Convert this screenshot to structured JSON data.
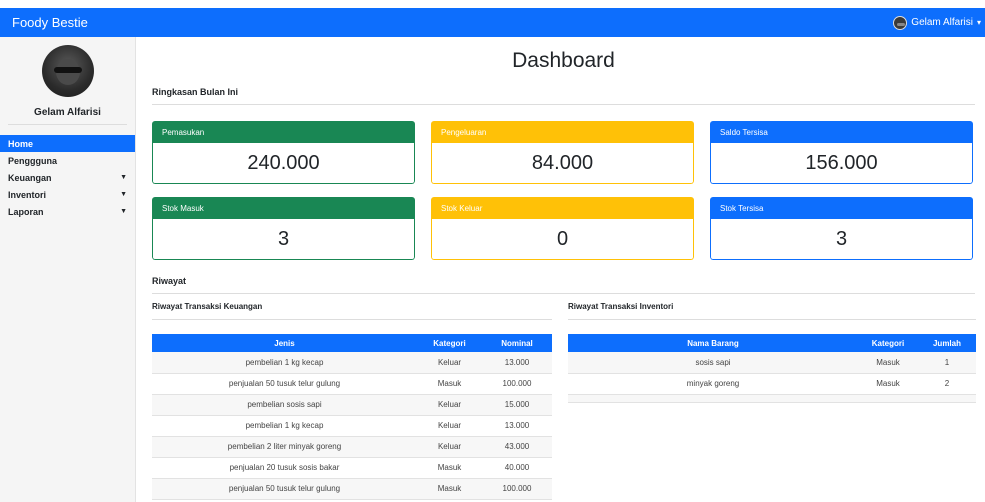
{
  "navbar": {
    "brand": "Foody Bestie",
    "user_name": "Gelam Alfarisi",
    "caret": "▾"
  },
  "sidebar": {
    "profile_name": "Gelam Alfarisi",
    "items": [
      {
        "label": "Home",
        "active": true,
        "arrow": ""
      },
      {
        "label": "Penggguna",
        "active": false,
        "arrow": ""
      },
      {
        "label": "Keuangan",
        "active": false,
        "arrow": "▼"
      },
      {
        "label": "Inventori",
        "active": false,
        "arrow": "▼"
      },
      {
        "label": "Laporan",
        "active": false,
        "arrow": "▼"
      }
    ]
  },
  "main": {
    "title": "Dashboard",
    "summary_label": "Ringkasan Bulan Ini",
    "cards": [
      {
        "label": "Pemasukan",
        "value": "240.000",
        "color": "#198754"
      },
      {
        "label": "Pengeluaran",
        "value": "84.000",
        "color": "#ffc107"
      },
      {
        "label": "Saldo Tersisa",
        "value": "156.000",
        "color": "#0d6efd"
      },
      {
        "label": "Stok Masuk",
        "value": "3",
        "color": "#198754"
      },
      {
        "label": "Stok Keluar",
        "value": "0",
        "color": "#ffc107"
      },
      {
        "label": "Stok Tersisa",
        "value": "3",
        "color": "#0d6efd"
      }
    ],
    "history_label": "Riwayat",
    "finance": {
      "title": "Riwayat Transaksi Keuangan",
      "headers": [
        "Jenis",
        "Kategori",
        "Nominal"
      ],
      "rows": [
        [
          "pembelian 1 kg kecap",
          "Keluar",
          "13.000"
        ],
        [
          "penjualan 50 tusuk telur gulung",
          "Masuk",
          "100.000"
        ],
        [
          "pembelian sosis sapi",
          "Keluar",
          "15.000"
        ],
        [
          "pembelian 1 kg kecap",
          "Keluar",
          "13.000"
        ],
        [
          "pembelian 2 liter minyak goreng",
          "Keluar",
          "43.000"
        ],
        [
          "penjualan 20 tusuk sosis bakar",
          "Masuk",
          "40.000"
        ],
        [
          "penjualan 50 tusuk telur gulung",
          "Masuk",
          "100.000"
        ]
      ]
    },
    "inventory": {
      "title": "Riwayat Transaksi Inventori",
      "headers": [
        "Nama Barang",
        "Kategori",
        "Jumlah"
      ],
      "rows": [
        [
          "sosis sapi",
          "Masuk",
          "1"
        ],
        [
          "minyak goreng",
          "Masuk",
          "2"
        ]
      ]
    }
  },
  "colors": {
    "primary": "#0d6efd",
    "success": "#198754",
    "warning": "#ffc107"
  }
}
